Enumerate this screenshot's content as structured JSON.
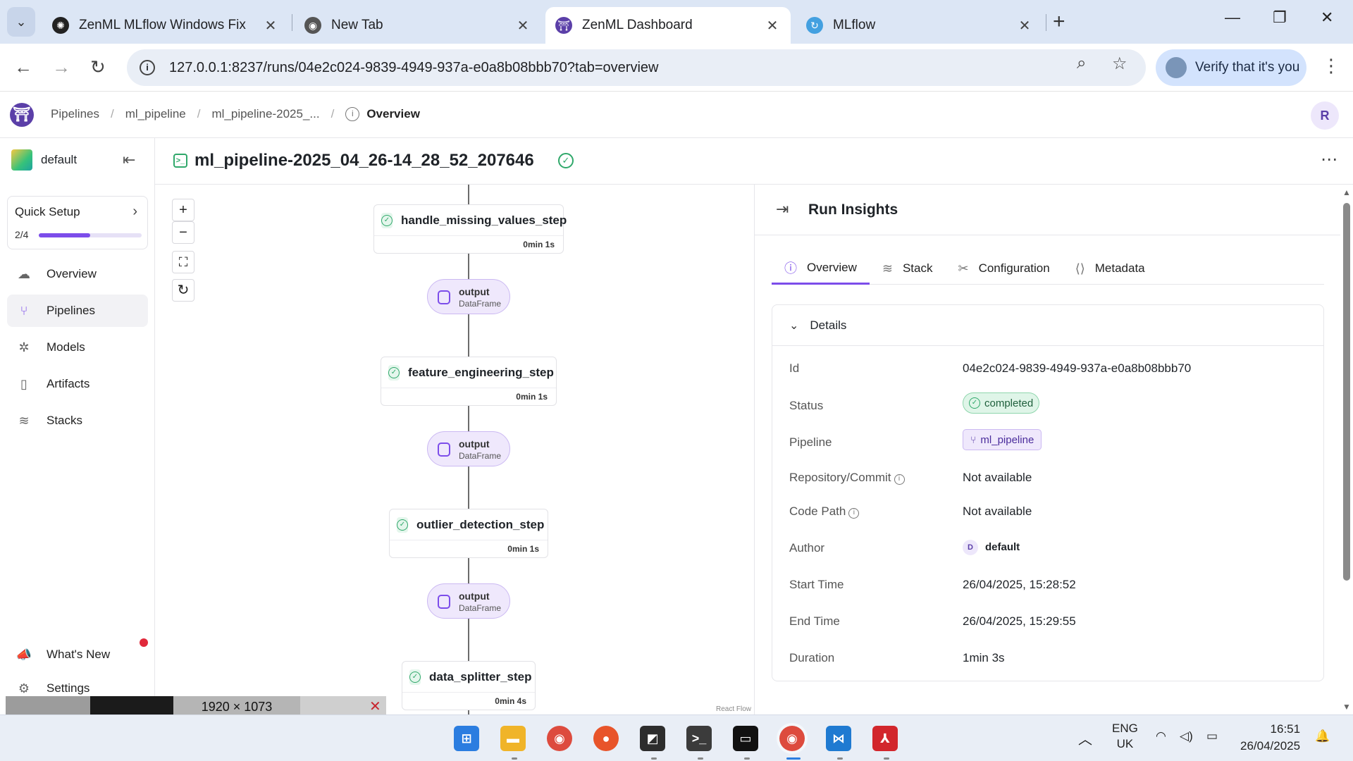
{
  "browser": {
    "tabs": [
      {
        "title": "ZenML MLflow Windows Fix",
        "active": false
      },
      {
        "title": "New Tab",
        "active": false
      },
      {
        "title": "ZenML Dashboard",
        "active": true
      },
      {
        "title": "MLflow",
        "active": false
      }
    ],
    "url": "127.0.0.1:8237/runs/04e2c024-9839-4949-937a-e0a8b08bbb70?tab=overview",
    "profile_button": "Verify that it's you"
  },
  "header": {
    "logo": "⛩",
    "breadcrumbs": [
      "Pipelines",
      "ml_pipeline",
      "ml_pipeline-2025_..."
    ],
    "current": "Overview",
    "user_initial": "R"
  },
  "sidebar": {
    "workspace": "default",
    "quick_setup": {
      "label": "Quick Setup",
      "progress_text": "2/4",
      "progress_fraction": 0.5
    },
    "items": [
      {
        "label": "Overview",
        "icon": "overview-icon",
        "active": false
      },
      {
        "label": "Pipelines",
        "icon": "pipelines-icon",
        "active": true
      },
      {
        "label": "Models",
        "icon": "models-icon",
        "active": false
      },
      {
        "label": "Artifacts",
        "icon": "artifacts-icon",
        "active": false
      },
      {
        "label": "Stacks",
        "icon": "stacks-icon",
        "active": false
      }
    ],
    "whats_new": "What's New",
    "settings": "Settings"
  },
  "run": {
    "title": "ml_pipeline-2025_04_26-14_28_52_207646"
  },
  "dag": {
    "steps": [
      {
        "name": "handle_missing_values_step",
        "duration": "0min 1s"
      },
      {
        "name": "feature_engineering_step",
        "duration": "0min 1s"
      },
      {
        "name": "outlier_detection_step",
        "duration": "0min 1s"
      },
      {
        "name": "data_splitter_step",
        "duration": "0min 4s"
      }
    ],
    "artifacts": [
      {
        "name": "output",
        "type": "DataFrame"
      },
      {
        "name": "output",
        "type": "DataFrame"
      },
      {
        "name": "output",
        "type": "DataFrame"
      }
    ],
    "attribution": "React Flow"
  },
  "insights": {
    "title": "Run Insights",
    "tabs": [
      "Overview",
      "Stack",
      "Configuration",
      "Metadata"
    ],
    "details_title": "Details",
    "rows": {
      "id_label": "Id",
      "id": "04e2c024-9839-4949-937a-e0a8b08bbb70",
      "status_label": "Status",
      "status": "completed",
      "pipeline_label": "Pipeline",
      "pipeline": "ml_pipeline",
      "repo_label": "Repository/Commit",
      "repo": "Not available",
      "codepath_label": "Code Path",
      "codepath": "Not available",
      "author_label": "Author",
      "author_initial": "D",
      "author": "default",
      "start_label": "Start Time",
      "start": "26/04/2025, 15:28:52",
      "end_label": "End Time",
      "end": "26/04/2025, 15:29:55",
      "duration_label": "Duration",
      "duration": "1min 3s"
    }
  },
  "capture_bar": {
    "size": "1920 × 1073"
  },
  "taskbar": {
    "lang": "ENG",
    "region": "UK",
    "time": "16:51",
    "date": "26/04/2025"
  }
}
